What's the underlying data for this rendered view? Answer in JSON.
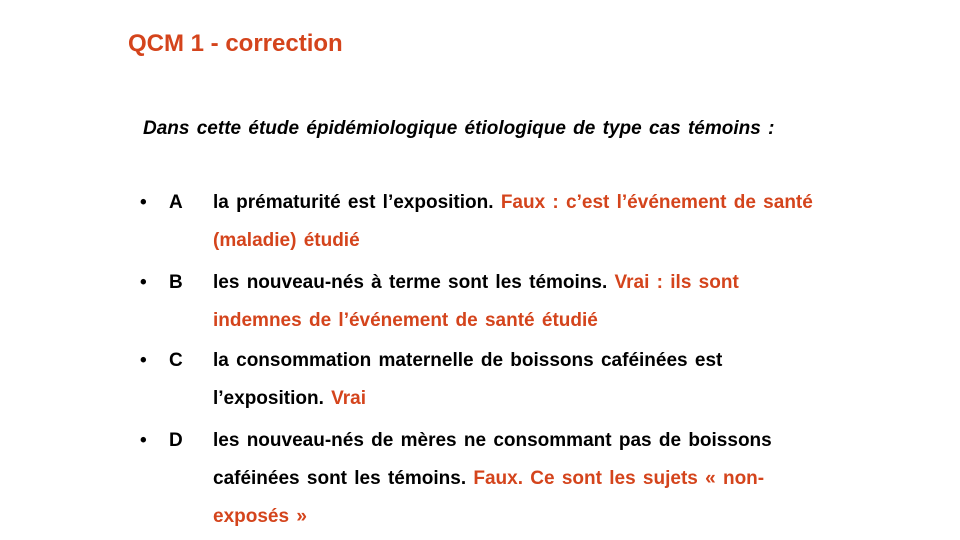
{
  "slide": {
    "title": "QCM 1 - correction",
    "intro": "Dans cette étude épidémiologique  étiologique  de type cas témoins :",
    "bullet_symbol": "•",
    "options": [
      {
        "letter": "A",
        "statement": "la prématurité  est l’exposition.",
        "correction": "Faux : c’est l’événement  de santé (maladie)  étudié"
      },
      {
        "letter": "B",
        "statement": "les nouveau-nés à terme sont les témoins.",
        "correction": "Vrai : ils sont indemnes  de l’événement de santé étudié"
      },
      {
        "letter": "C",
        "statement": "la consommation  maternelle  de boissons  caféinées  est l’exposition.",
        "correction": "Vrai"
      },
      {
        "letter": "D",
        "statement": "les nouveau-nés de mères ne consommant  pas de boissons  caféinées  sont les témoins.",
        "correction": "Faux. Ce sont les sujets « non-exposés  »"
      }
    ],
    "colors": {
      "accent": "#d4441c",
      "text": "#000000",
      "background": "#ffffff"
    }
  }
}
